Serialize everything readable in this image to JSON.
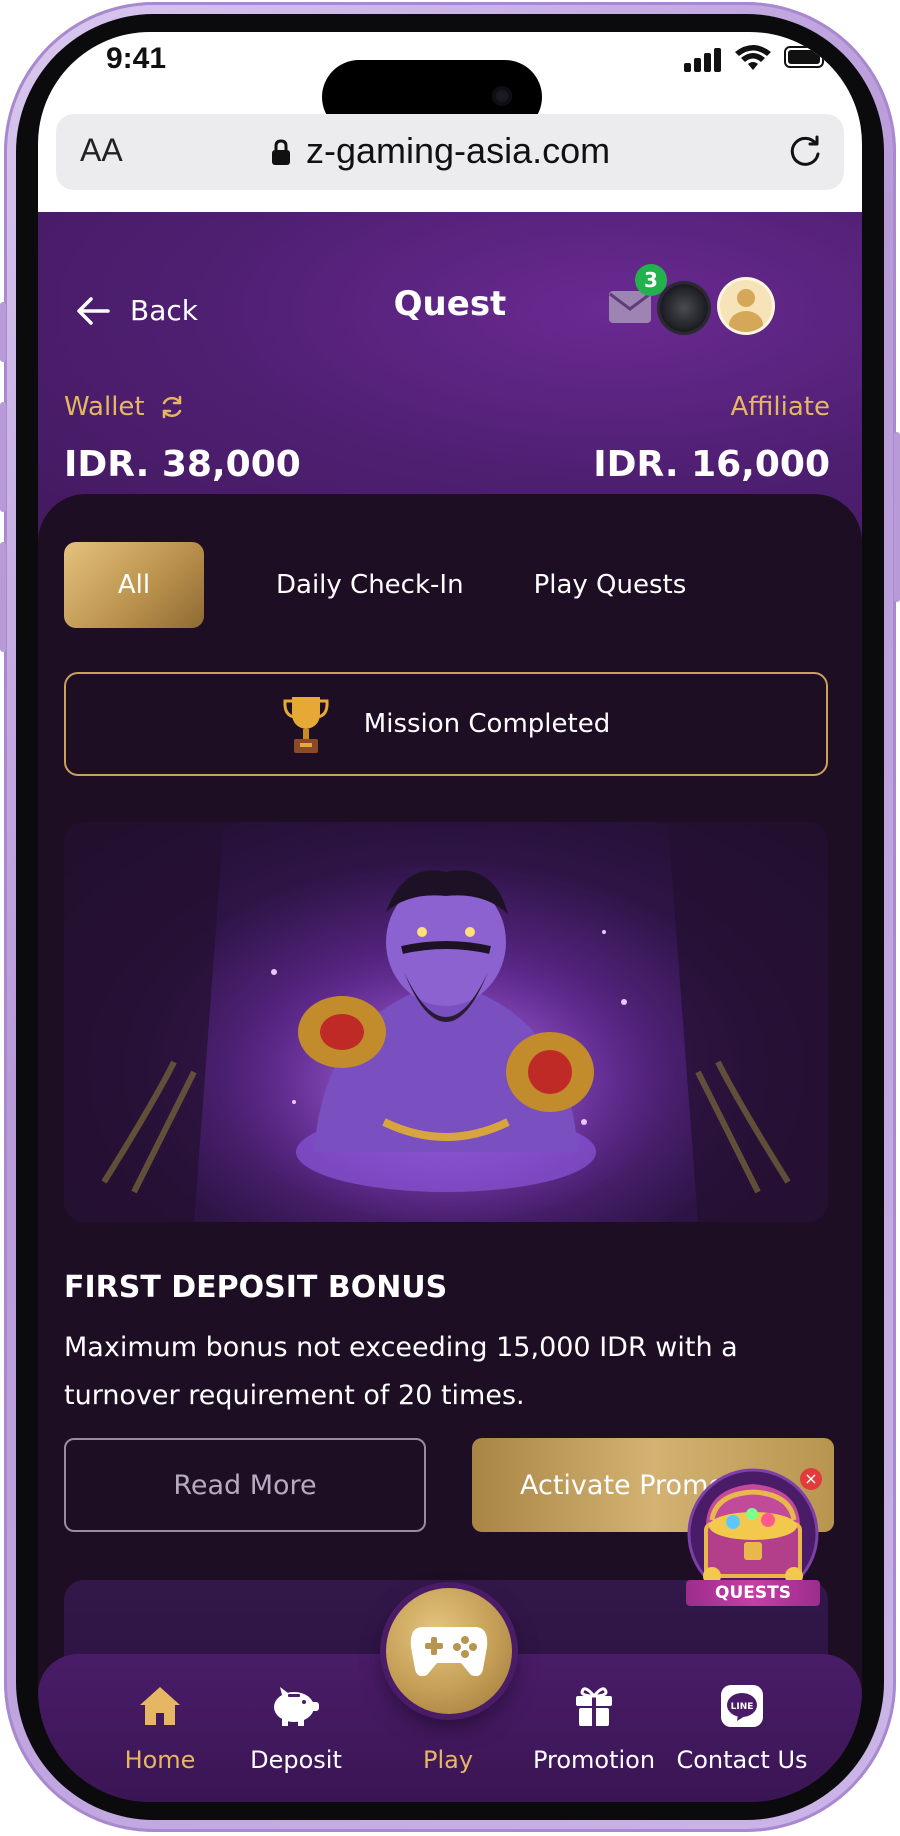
{
  "status_bar": {
    "time": "9:41"
  },
  "browser": {
    "text_size": "AA",
    "url": "z-gaming-asia.com"
  },
  "header": {
    "back_label": "Back",
    "title": "Quest",
    "mail_badge": "3"
  },
  "wallet": {
    "label": "Wallet",
    "value": "IDR. 38,000"
  },
  "affiliate": {
    "label": "Affiliate",
    "value": "IDR. 16,000"
  },
  "tabs": [
    {
      "label": "All",
      "active": true
    },
    {
      "label": "Daily Check-In",
      "active": false
    },
    {
      "label": "Play Quests",
      "active": false
    }
  ],
  "mission": {
    "label": "Mission Completed"
  },
  "promo": {
    "title": "FIRST DEPOSIT BONUS",
    "description": "Maximum bonus not exceeding 15,000 IDR with a turnover requirement of 20 times.",
    "read_more": "Read More",
    "activate": "Activate Promo"
  },
  "quests_widget": {
    "label": "QUESTS"
  },
  "nav": [
    {
      "label": "Home",
      "icon": "home-icon",
      "active": true
    },
    {
      "label": "Deposit",
      "icon": "piggy-bank-icon",
      "active": false
    },
    {
      "label": "Play",
      "icon": "gamepad-icon",
      "active": true
    },
    {
      "label": "Promotion",
      "icon": "gift-icon",
      "active": false
    },
    {
      "label": "Contact Us",
      "icon": "line-icon",
      "active": false
    }
  ],
  "colors": {
    "accent_gold": "#e5b763",
    "header_purple": "#4f1f72",
    "panel_bg": "#1d0e24",
    "badge_green": "#22b14c"
  }
}
